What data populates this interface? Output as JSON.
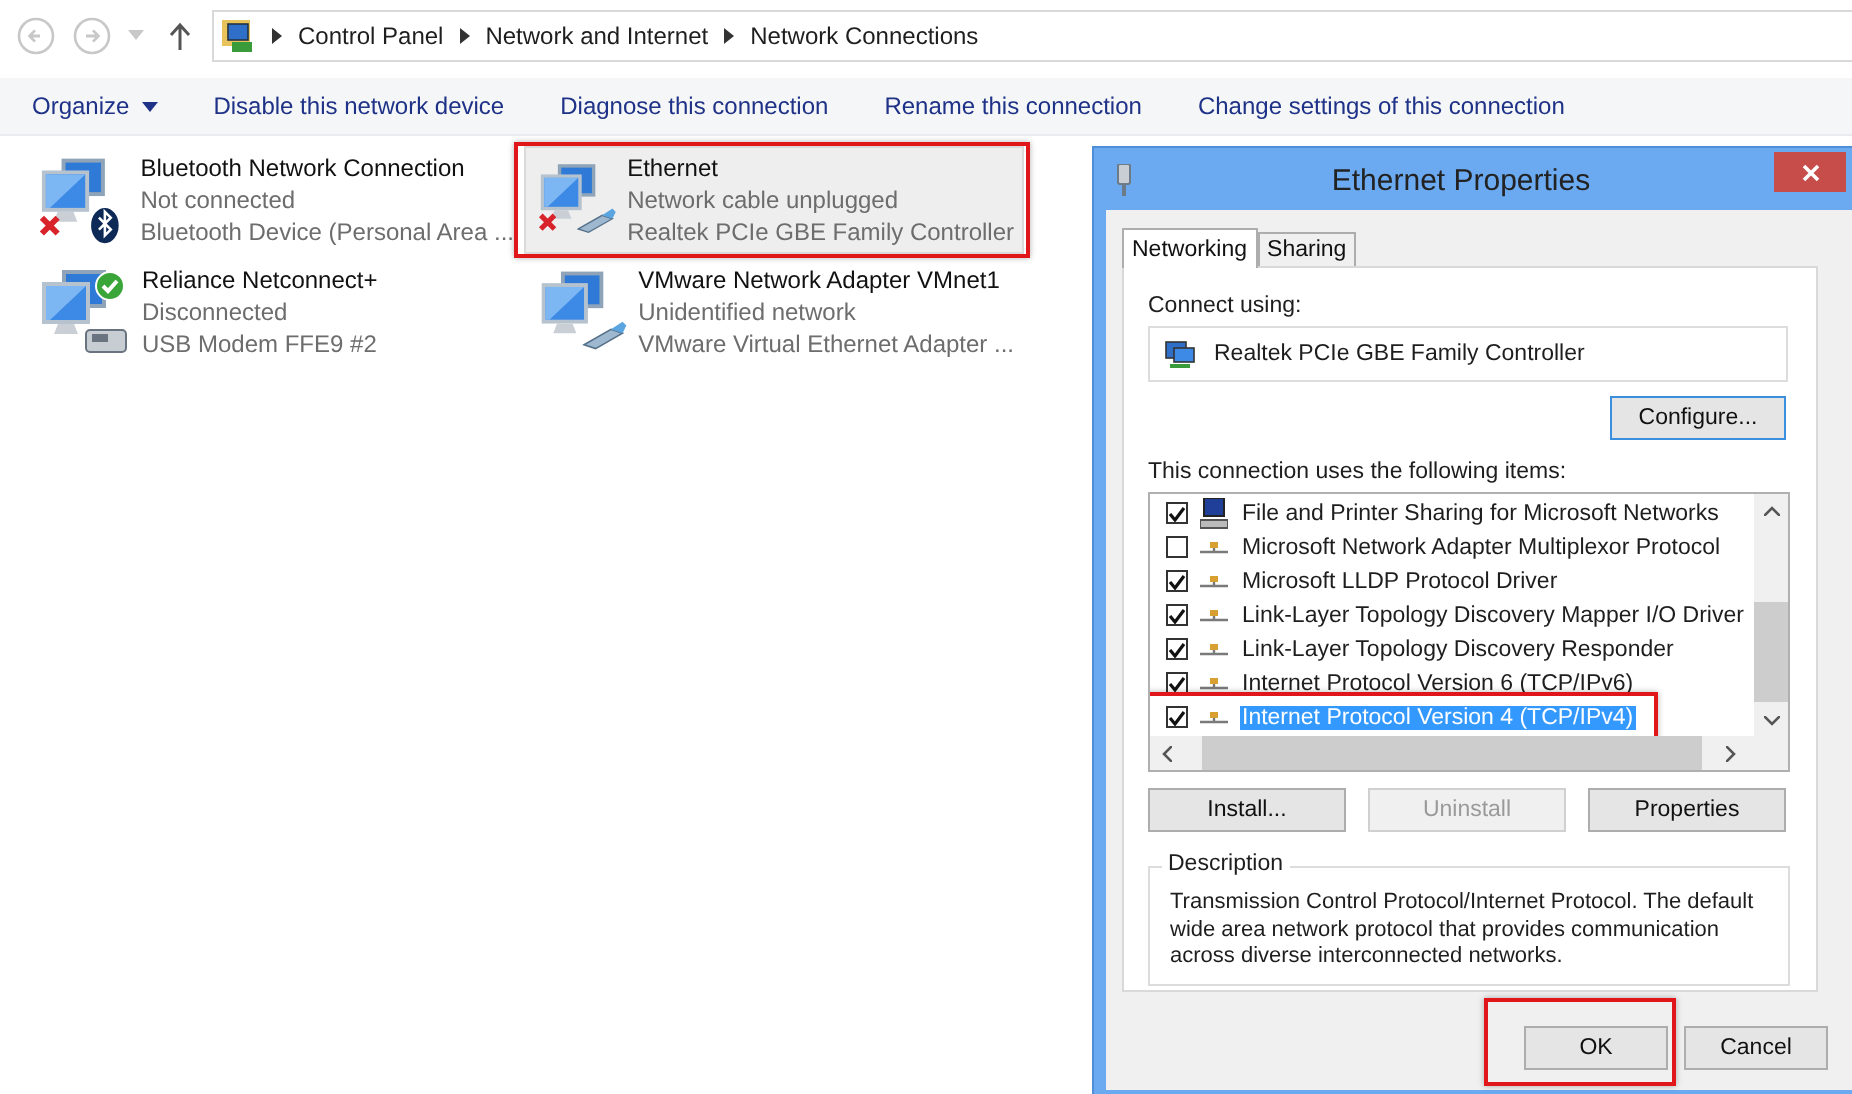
{
  "address_bar": {
    "crumbs": [
      "Control Panel",
      "Network and Internet",
      "Network Connections"
    ]
  },
  "toolbar": {
    "items": [
      {
        "label": "Organize",
        "kind": "menu"
      },
      {
        "label": "Disable this network device",
        "kind": "command"
      },
      {
        "label": "Diagnose this connection",
        "kind": "command"
      },
      {
        "label": "Rename this connection",
        "kind": "command"
      },
      {
        "label": "Change settings of this connection",
        "kind": "command"
      }
    ]
  },
  "connections": [
    {
      "name": "Bluetooth Network Connection",
      "status": "Not connected",
      "device": "Bluetooth Device (Personal Area ...",
      "error": true,
      "ok": false,
      "kind": "bluetooth",
      "selected": false,
      "annotated": false
    },
    {
      "name": "Ethernet",
      "status": "Network cable unplugged",
      "device": "Realtek PCIe GBE Family Controller",
      "error": true,
      "ok": false,
      "kind": "cable",
      "selected": true,
      "annotated": true
    },
    {
      "name": "Reliance Netconnect+",
      "status": "Disconnected",
      "device": "USB Modem FFE9 #2",
      "error": false,
      "ok": true,
      "kind": "modem",
      "selected": false,
      "annotated": false
    },
    {
      "name": "VMware Network Adapter VMnet1",
      "status": "Unidentified network",
      "device": "VMware Virtual Ethernet Adapter ...",
      "error": false,
      "ok": false,
      "kind": "cable",
      "selected": false,
      "annotated": false
    }
  ],
  "dialog": {
    "title": "Ethernet Properties",
    "tabs": [
      {
        "label": "Networking",
        "selected": true
      },
      {
        "label": "Sharing",
        "selected": false
      }
    ],
    "connect_using_label": "Connect using:",
    "adapter": "Realtek PCIe GBE Family Controller",
    "configure_button": "Configure...",
    "items_label": "This connection uses the following items:",
    "items": [
      {
        "label": "File and Printer Sharing for Microsoft Networks",
        "kind": "computer",
        "checked": true,
        "selected": false,
        "annotated": false
      },
      {
        "label": "Microsoft Network Adapter Multiplexor Protocol",
        "kind": "protocol",
        "checked": false,
        "selected": false,
        "annotated": false
      },
      {
        "label": "Microsoft LLDP Protocol Driver",
        "kind": "protocol",
        "checked": true,
        "selected": false,
        "annotated": false
      },
      {
        "label": "Link-Layer Topology Discovery Mapper I/O Driver",
        "kind": "protocol",
        "checked": true,
        "selected": false,
        "annotated": false
      },
      {
        "label": "Link-Layer Topology Discovery Responder",
        "kind": "protocol",
        "checked": true,
        "selected": false,
        "annotated": false
      },
      {
        "label": "Internet Protocol Version 6 (TCP/IPv6)",
        "kind": "protocol",
        "checked": true,
        "selected": false,
        "annotated": false
      },
      {
        "label": "Internet Protocol Version 4 (TCP/IPv4)",
        "kind": "protocol",
        "checked": true,
        "selected": true,
        "annotated": true
      }
    ],
    "item_buttons": [
      {
        "label": "Install...",
        "disabled": false
      },
      {
        "label": "Uninstall",
        "disabled": true
      },
      {
        "label": "Properties",
        "disabled": false
      }
    ],
    "description_title": "Description",
    "description": "Transmission Control Protocol/Internet Protocol. The default wide area network protocol that provides communication across diverse interconnected networks.",
    "footer_buttons": [
      {
        "label": "OK",
        "annotated": true
      },
      {
        "label": "Cancel"
      }
    ]
  }
}
